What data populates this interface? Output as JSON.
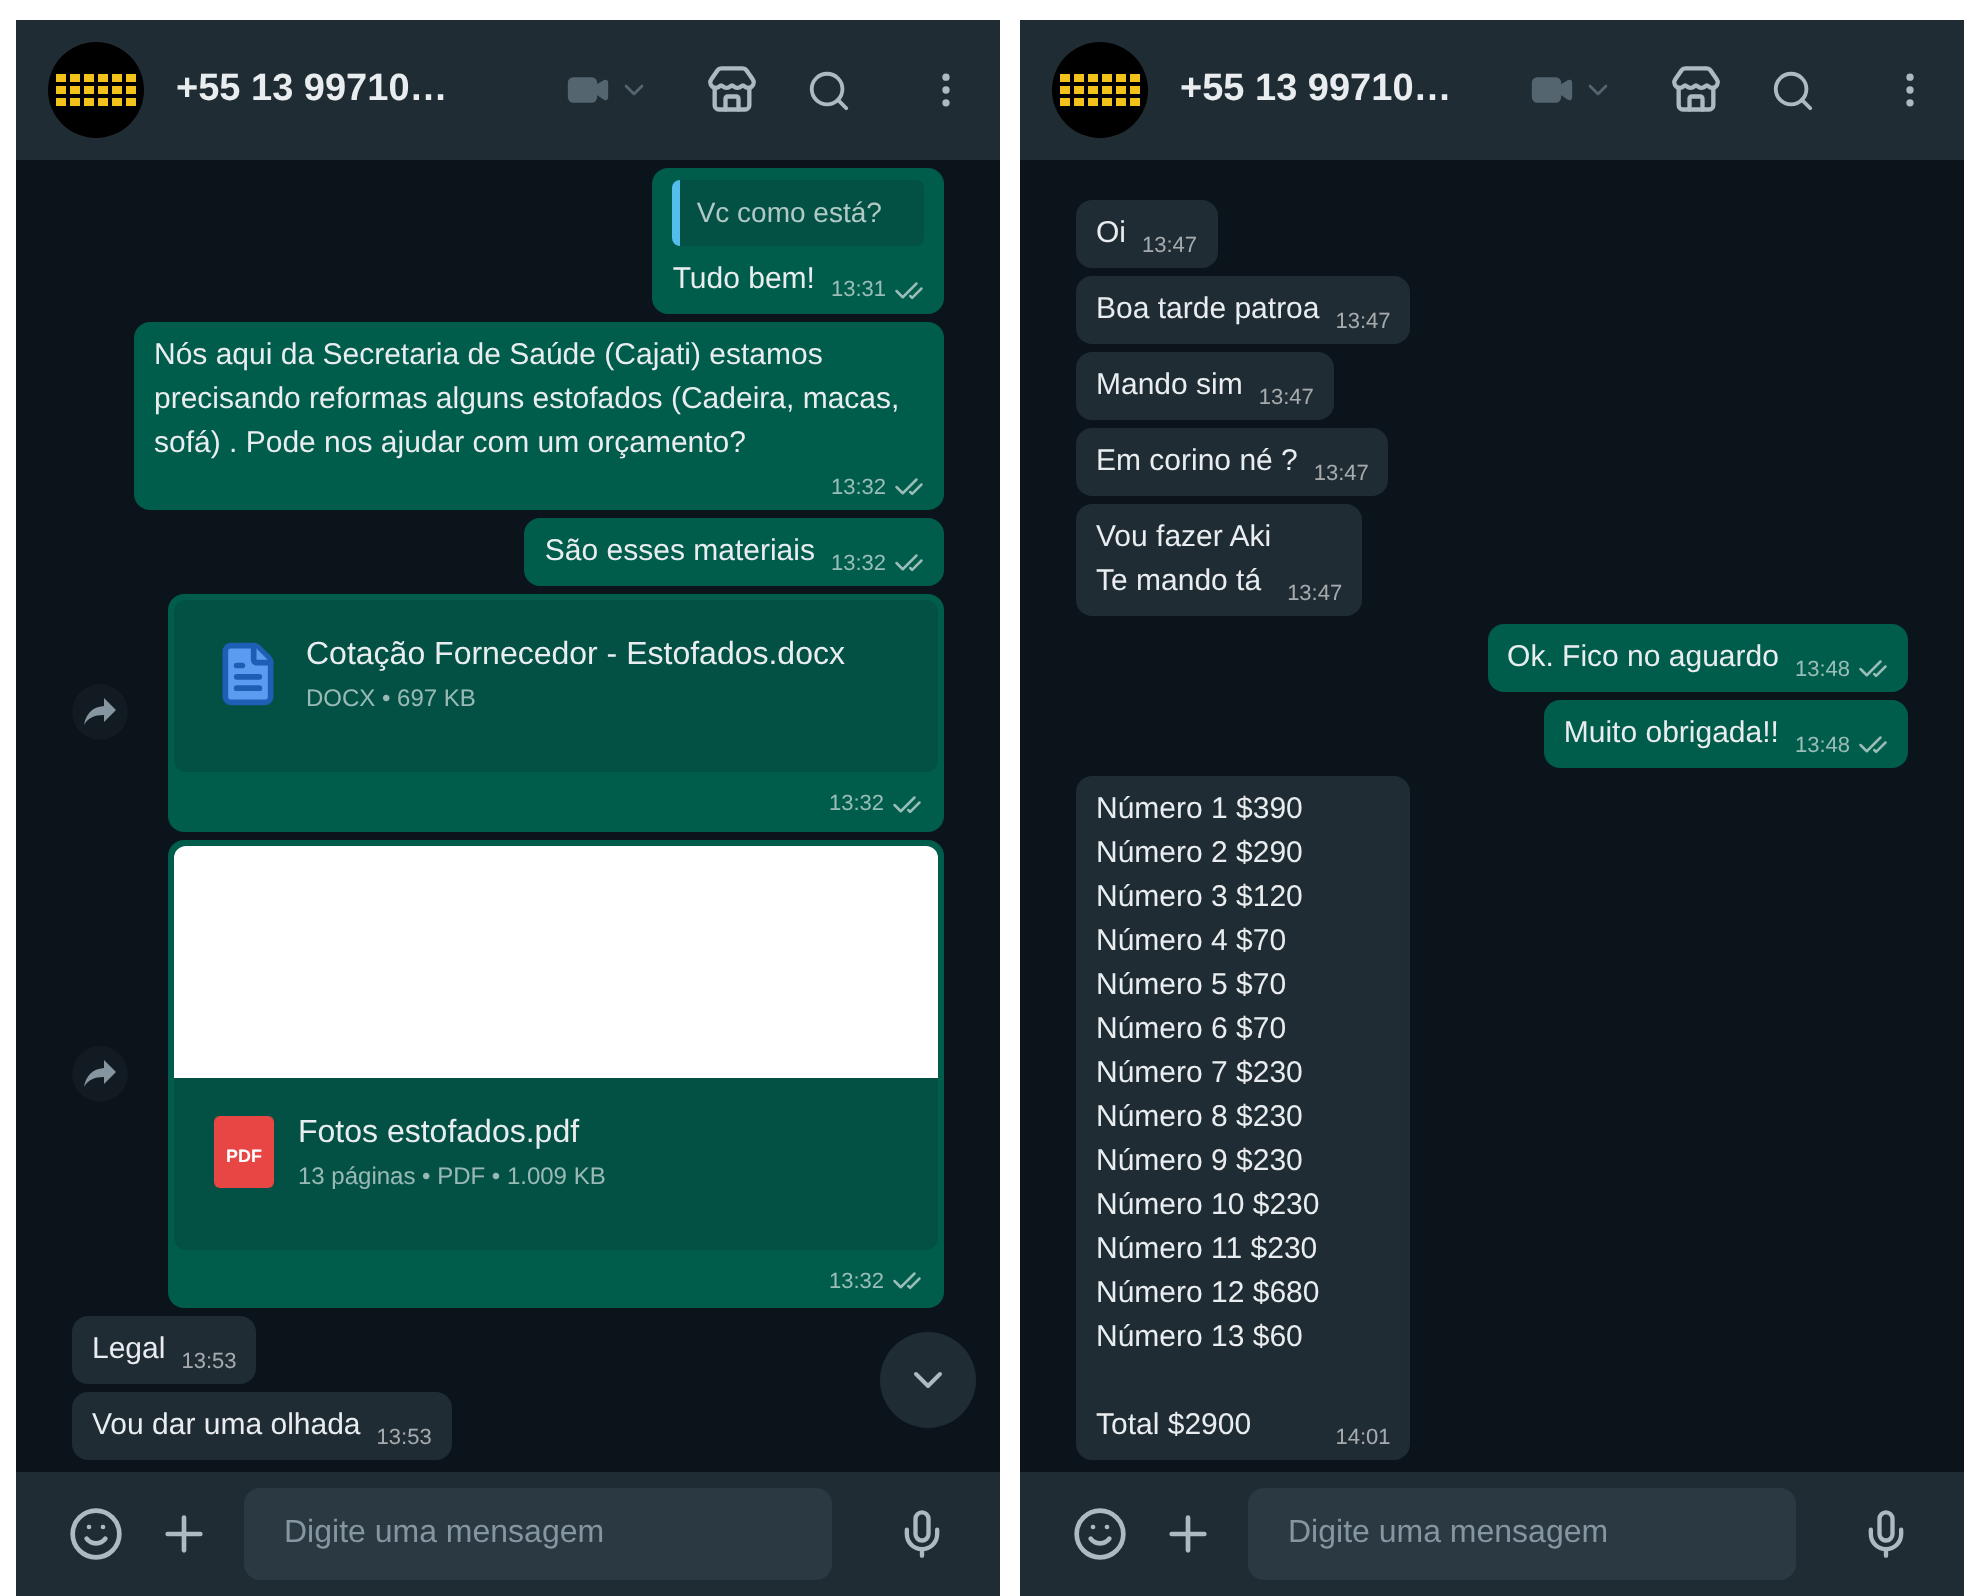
{
  "panels": [
    {
      "header": {
        "name": "+55 13 99710…"
      },
      "messages": [
        {
          "kind": "out",
          "quote": "Vc como está?",
          "text": "Tudo bem!",
          "time": "13:31"
        },
        {
          "kind": "out",
          "text": "Nós aqui da Secretaria de Saúde (Cajati) estamos precisando reformas alguns estofados (Cadeira, macas, sofá) . Pode nos ajudar com um orçamento?",
          "time": "13:32"
        },
        {
          "kind": "out",
          "text": "São esses materiais",
          "time": "13:32"
        },
        {
          "kind": "docx_file",
          "name": "Cotação Fornecedor - Estofados.docx",
          "meta": "DOCX • 697 KB",
          "time": "13:32",
          "preview": false
        },
        {
          "kind": "pdf_file",
          "icon_label": "PDF",
          "name": "Fotos estofados.pdf",
          "meta": "13 páginas • PDF • 1.009 KB",
          "time": "13:32",
          "preview": true
        },
        {
          "kind": "in",
          "text": "Legal",
          "time": "13:53"
        },
        {
          "kind": "in",
          "text": "Vou dar uma olhada",
          "time": "13:53"
        }
      ],
      "scroll_down_button": true,
      "composer": {
        "placeholder": "Digite uma mensagem"
      }
    },
    {
      "header": {
        "name": "+55 13 99710…"
      },
      "messages": [
        {
          "kind": "in",
          "text": "Oi",
          "time": "13:47"
        },
        {
          "kind": "in",
          "text": "Boa tarde patroa",
          "time": "13:47"
        },
        {
          "kind": "in",
          "text": "Mando sim",
          "time": "13:47"
        },
        {
          "kind": "in",
          "text": "Em corino né ?",
          "time": "13:47"
        },
        {
          "kind": "in",
          "text": "Vou fazer Aki\nTe mando tá",
          "time": "13:47"
        },
        {
          "kind": "out",
          "text": "Ok. Fico no aguardo",
          "time": "13:48"
        },
        {
          "kind": "out",
          "text": "Muito obrigada!!",
          "time": "13:48"
        },
        {
          "kind": "in",
          "text": "Número 1 $390\nNúmero 2 $290\nNúmero 3 $120\nNúmero 4 $70\nNúmero 5 $70\nNúmero 6 $70\nNúmero 7 $230\nNúmero 8 $230\nNúmero 9 $230\nNúmero 10 $230\nNúmero 11 $230\nNúmero 12 $680\nNúmero 13 $60\n\nTotal $2900",
          "time": "14:01"
        }
      ],
      "scroll_down_button": false,
      "composer": {
        "placeholder": "Digite uma mensagem"
      }
    }
  ]
}
